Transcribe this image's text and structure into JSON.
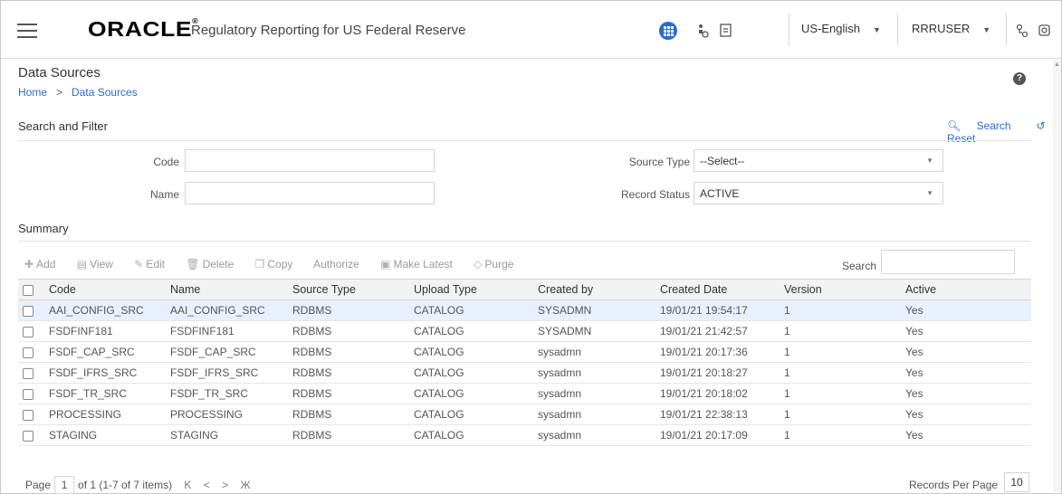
{
  "header": {
    "logo_text": "ORACLE",
    "logo_mark": "®",
    "app_title": "Regulatory Reporting for US Federal Reserve",
    "language": "US-English",
    "user": "RRRUSER"
  },
  "page": {
    "title": "Data Sources",
    "breadcrumb": {
      "home": "Home",
      "separator": ">",
      "current": "Data Sources"
    },
    "help": "?"
  },
  "search_filter": {
    "title": "Search and Filter",
    "search_label": "Search",
    "reset_label": "Reset",
    "code_label": "Code",
    "code_value": "",
    "name_label": "Name",
    "name_value": "",
    "source_type_label": "Source Type",
    "source_type_value": "--Select--",
    "record_status_label": "Record Status",
    "record_status_value": "ACTIVE"
  },
  "summary": {
    "title": "Summary",
    "toolbar": {
      "add": "Add",
      "view": "View",
      "edit": "Edit",
      "delete": "Delete",
      "copy": "Copy",
      "authorize": "Authorize",
      "make_latest": "Make Latest",
      "purge": "Purge"
    },
    "search_label": "Search",
    "columns": [
      "Code",
      "Name",
      "Source Type",
      "Upload Type",
      "Created by",
      "Created Date",
      "Version",
      "Active"
    ],
    "rows": [
      [
        "AAI_CONFIG_SRC",
        "AAI_CONFIG_SRC",
        "RDBMS",
        "CATALOG",
        "SYSADMN",
        "19/01/21 19:54:17",
        "1",
        "Yes"
      ],
      [
        "FSDFINF181",
        "FSDFINF181",
        "RDBMS",
        "CATALOG",
        "SYSADMN",
        "19/01/21 21:42:57",
        "1",
        "Yes"
      ],
      [
        "FSDF_CAP_SRC",
        "FSDF_CAP_SRC",
        "RDBMS",
        "CATALOG",
        "sysadmn",
        "19/01/21 20:17:36",
        "1",
        "Yes"
      ],
      [
        "FSDF_IFRS_SRC",
        "FSDF_IFRS_SRC",
        "RDBMS",
        "CATALOG",
        "sysadmn",
        "19/01/21 20:18:27",
        "1",
        "Yes"
      ],
      [
        "FSDF_TR_SRC",
        "FSDF_TR_SRC",
        "RDBMS",
        "CATALOG",
        "sysadmn",
        "19/01/21 20:18:02",
        "1",
        "Yes"
      ],
      [
        "PROCESSING",
        "PROCESSING",
        "RDBMS",
        "CATALOG",
        "sysadmn",
        "19/01/21 22:38:13",
        "1",
        "Yes"
      ],
      [
        "STAGING",
        "STAGING",
        "RDBMS",
        "CATALOG",
        "sysadmn",
        "19/01/21 20:17:09",
        "1",
        "Yes"
      ]
    ]
  },
  "pagination": {
    "page_label": "Page",
    "page_value": "1",
    "of_text": "of 1 (1-7 of 7 items)",
    "first": "K",
    "prev": "<",
    "next": ">",
    "last": "Ж",
    "records_per_page_label": "Records Per Page",
    "records_per_page_value": "10"
  },
  "colors": {
    "accent": "#2a6ad3",
    "selected_row": "#e8f0fb",
    "header_bg": "#f2f2f2"
  }
}
